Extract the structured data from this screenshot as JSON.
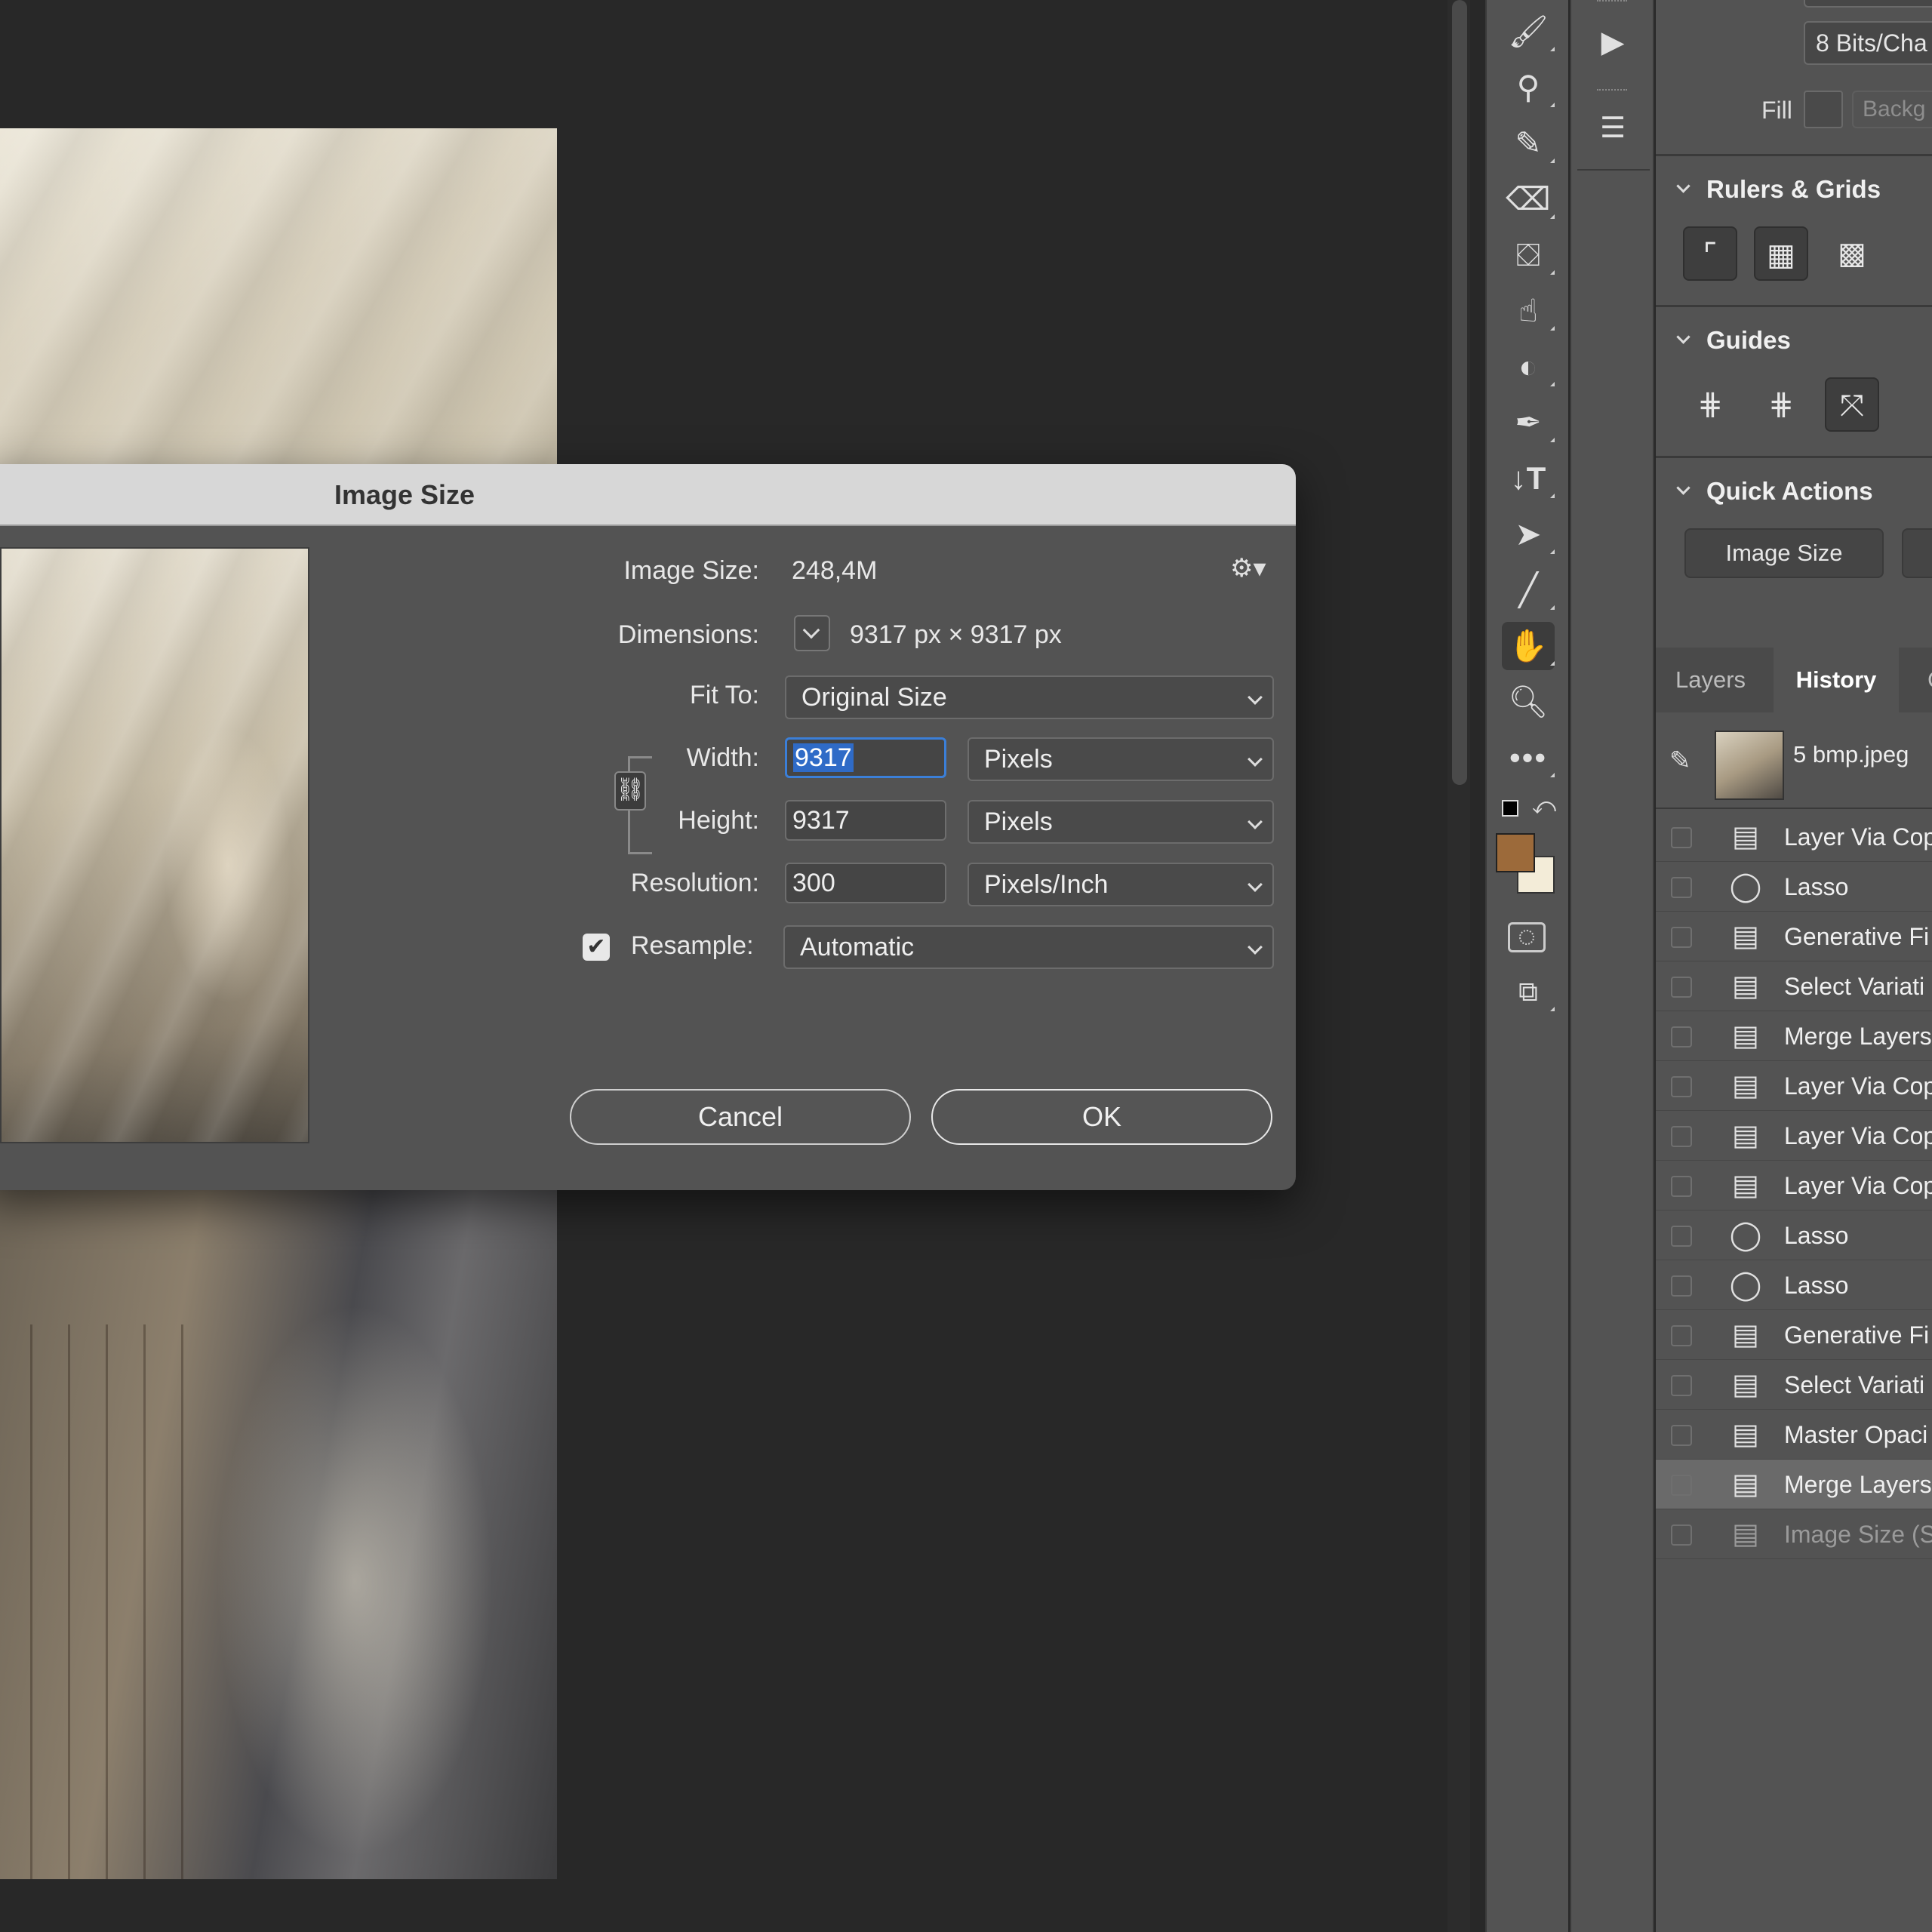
{
  "dialog": {
    "title": "Image Size",
    "image_size_label": "Image Size:",
    "image_size_value": "248,4M",
    "dimensions_label": "Dimensions:",
    "dimensions_value": "9317 px  ×  9317 px",
    "fit_to_label": "Fit To:",
    "fit_to_value": "Original Size",
    "width_label": "Width:",
    "width_value": "9317",
    "width_unit": "Pixels",
    "height_label": "Height:",
    "height_value": "9317",
    "height_unit": "Pixels",
    "resolution_label": "Resolution:",
    "resolution_value": "300",
    "resolution_unit": "Pixels/Inch",
    "resample_label": "Resample:",
    "resample_checked": true,
    "resample_value": "Automatic",
    "cancel_label": "Cancel",
    "ok_label": "OK"
  },
  "toolbar": {
    "tools": [
      "brush-icon",
      "stamp-icon",
      "history-brush-icon",
      "eraser-icon",
      "paint-bucket-icon",
      "smudge-icon",
      "dodge-icon",
      "pen-icon",
      "type-icon",
      "path-select-icon",
      "line-icon",
      "hand-icon",
      "zoom-icon",
      "more-icon"
    ],
    "active_tool": "hand-icon",
    "foreground_color": "#9c6a3a",
    "background_color": "#f3ecd8"
  },
  "properties": {
    "bit_depth": "8 Bits/Cha",
    "fill_label": "Fill",
    "fill_value": "Backg",
    "rulers_title": "Rulers & Grids",
    "guides_title": "Guides",
    "quick_actions_title": "Quick Actions",
    "quick_action_button": "Image Size"
  },
  "history": {
    "tabs": [
      "Layers",
      "History",
      "C"
    ],
    "active_tab": "History",
    "snapshot_name": "5 bmp.jpeg",
    "items": [
      {
        "icon": "document-icon",
        "label": "Layer Via Cop"
      },
      {
        "icon": "lasso-icon",
        "label": "Lasso"
      },
      {
        "icon": "document-icon",
        "label": "Generative Fi"
      },
      {
        "icon": "document-icon",
        "label": "Select Variati"
      },
      {
        "icon": "document-icon",
        "label": "Merge Layers"
      },
      {
        "icon": "document-icon",
        "label": "Layer Via Cop"
      },
      {
        "icon": "document-icon",
        "label": "Layer Via Cop"
      },
      {
        "icon": "document-icon",
        "label": "Layer Via Cop"
      },
      {
        "icon": "lasso-icon",
        "label": "Lasso"
      },
      {
        "icon": "lasso-icon",
        "label": "Lasso"
      },
      {
        "icon": "document-icon",
        "label": "Generative Fi"
      },
      {
        "icon": "document-icon",
        "label": "Select Variati"
      },
      {
        "icon": "document-icon",
        "label": "Master Opaci"
      },
      {
        "icon": "document-icon",
        "label": "Merge Layers"
      },
      {
        "icon": "document-icon",
        "label": "Image Size (S"
      }
    ],
    "selected_index": 13,
    "disabled_index": 14
  }
}
